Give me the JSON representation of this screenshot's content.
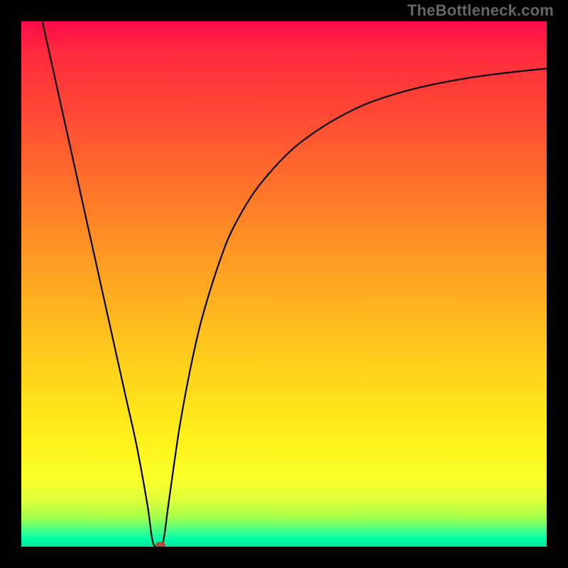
{
  "watermark": "TheBottleneck.com",
  "colors": {
    "frame_bg": "#000000",
    "curve": "#000000",
    "marker": "#b44a3a",
    "gradient_stops": [
      "#ff0a4a",
      "#ff2a3e",
      "#ff4a34",
      "#ff7a28",
      "#ffa820",
      "#ffd21a",
      "#fff21a",
      "#fbff2a",
      "#e0ff3a",
      "#a0ff4a",
      "#40ff8a",
      "#00ffa8",
      "#00e8a0"
    ]
  },
  "chart_data": {
    "type": "line",
    "title": "",
    "xlabel": "",
    "ylabel": "",
    "xlim": [
      0,
      100
    ],
    "ylim": [
      0,
      100
    ],
    "x": [
      4,
      6,
      8,
      10,
      12,
      14,
      16,
      18,
      20,
      22,
      24,
      25,
      26,
      27,
      28,
      30,
      32,
      34,
      36,
      38,
      40,
      44,
      48,
      52,
      56,
      60,
      65,
      70,
      75,
      80,
      85,
      90,
      95,
      100
    ],
    "values": [
      100,
      91,
      82,
      73,
      64,
      55,
      46,
      37,
      28,
      19,
      8,
      1,
      0,
      1,
      8,
      22,
      33,
      42,
      49,
      55,
      60,
      67,
      72,
      76,
      79,
      81.5,
      84,
      85.8,
      87.2,
      88.3,
      89.2,
      89.9,
      90.5,
      91
    ],
    "marker": {
      "x": 26.5,
      "y": 0
    },
    "background": "vertical red→green gradient (bottleneck heatmap)"
  }
}
